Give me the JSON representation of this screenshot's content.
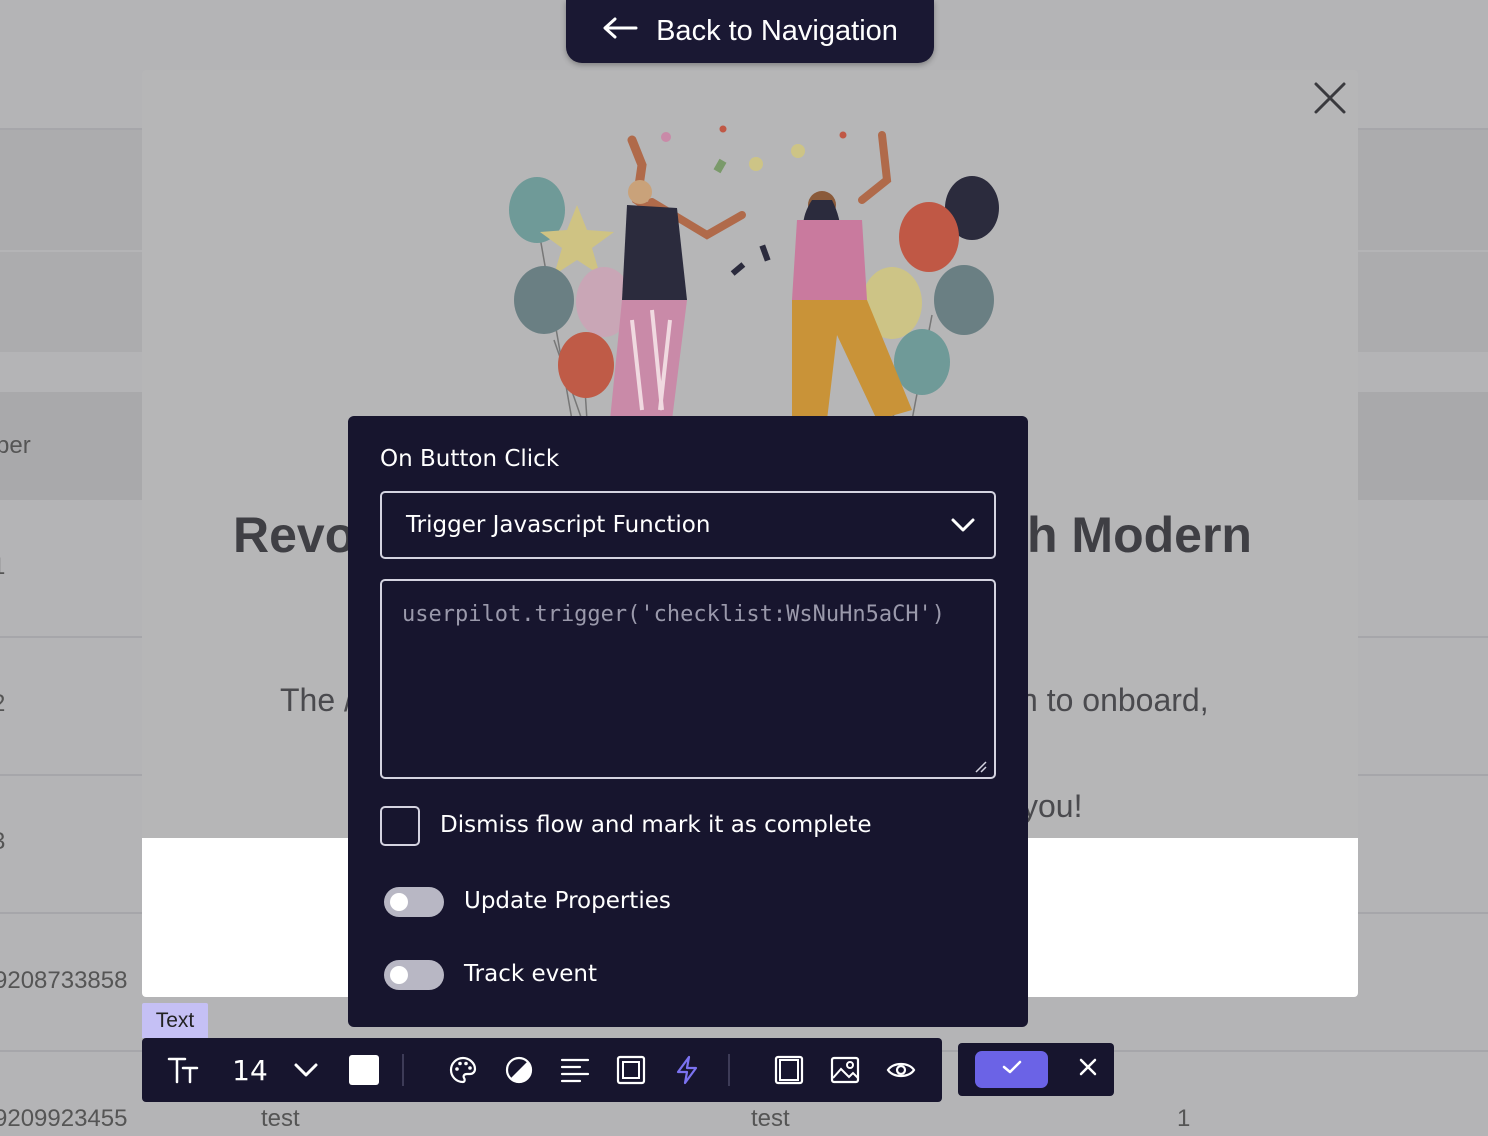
{
  "navigation": {
    "back_label": "Back to Navigation"
  },
  "background_table": {
    "header_fragment": "per",
    "row_fragments": [
      "1",
      "2",
      "3",
      "9208733858",
      "9209923455"
    ],
    "last_row": [
      "test",
      "test",
      "1"
    ]
  },
  "modal": {
    "heading_left": "Revo",
    "heading_right": "h Modern",
    "body_line_1_left": "The /",
    "body_line_1_right": "n to onboard,",
    "body_line_3_right": "you!"
  },
  "popover": {
    "title": "On Button Click",
    "action_selected": "Trigger Javascript Function",
    "code_value": "userpilot.trigger('checklist:WsNuHn5aCH')",
    "dismiss_label": "Dismiss flow and mark it as complete",
    "dismiss_checked": false,
    "update_properties_label": "Update Properties",
    "update_properties_on": false,
    "track_event_label": "Track event",
    "track_event_on": false
  },
  "toolbar": {
    "element_tag": "Text",
    "font_size": "14",
    "text_color": "#ffffff",
    "icons": [
      "text-size-icon",
      "chevron-down-icon",
      "palette-icon",
      "contrast-icon",
      "align-left-icon",
      "padding-icon",
      "lightning-icon",
      "frame-icon",
      "image-icon",
      "eye-icon",
      "check-icon",
      "close-icon"
    ]
  },
  "colors": {
    "accent": "#6b63e6",
    "panel": "#17152e",
    "tag": "#c5c0f5"
  }
}
